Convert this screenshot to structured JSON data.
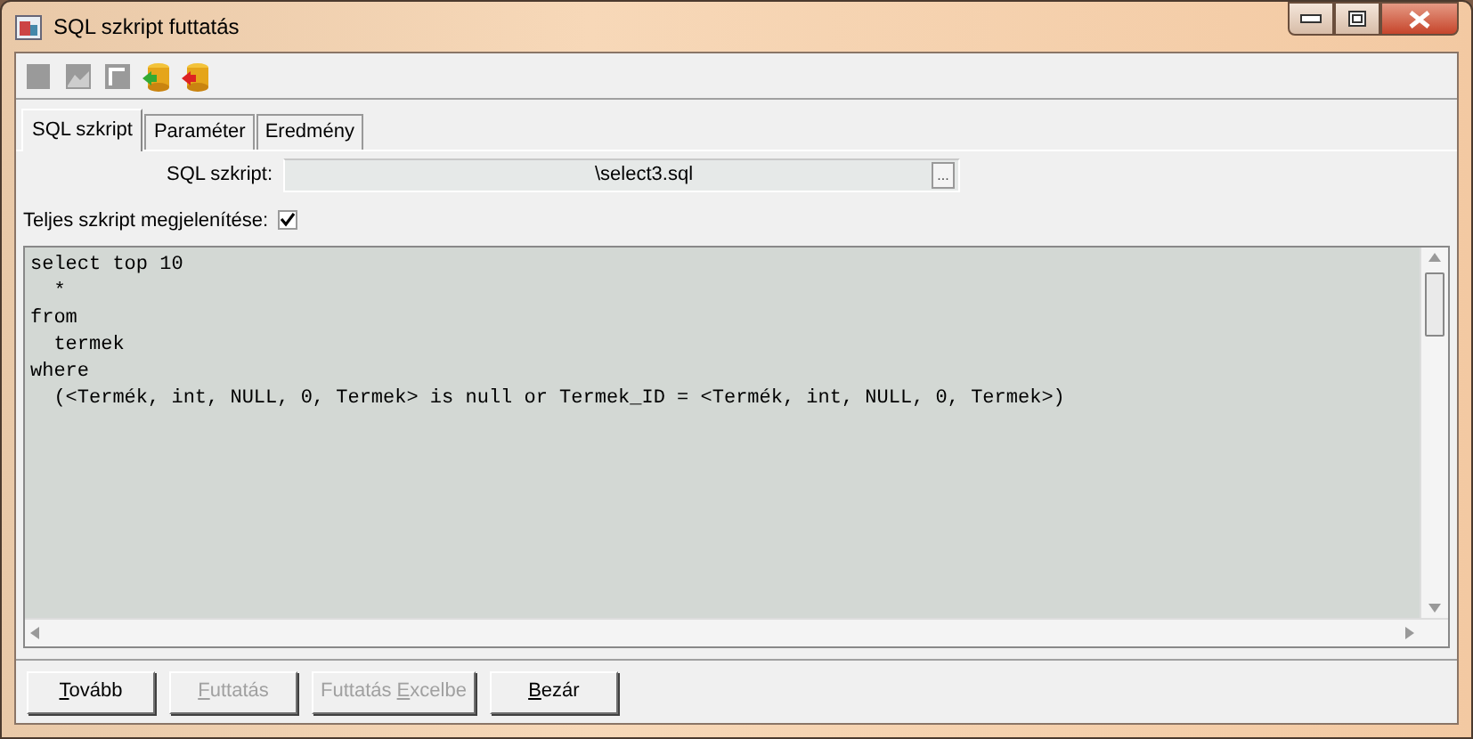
{
  "window": {
    "title": "SQL szkript futtatás"
  },
  "toolbar": [
    {
      "disabled": true
    },
    {
      "disabled": true
    },
    {
      "disabled": true
    },
    {
      "disabled": false
    },
    {
      "disabled": false
    }
  ],
  "tabs": [
    {
      "label": "SQL szkript",
      "selected": true
    },
    {
      "label": "Paraméter",
      "selected": false
    },
    {
      "label": "Eredmény",
      "selected": false
    }
  ],
  "script_field": {
    "label": "SQL szkript:",
    "value": "\\select3.sql",
    "browse": "..."
  },
  "show_full": {
    "label": "Teljes szkript megjelenítése:",
    "checked": true
  },
  "editor_lines": [
    "select top 10",
    "  *",
    "from",
    "  termek",
    "where",
    "  (<Termék, int, NULL, 0, Termek> is null or Termek_ID = <Termék, int, NULL, 0, Termek>)"
  ],
  "buttons": [
    {
      "key": "T",
      "rest": "ovább",
      "disabled": false
    },
    {
      "key": "F",
      "rest": "uttatás",
      "disabled": true
    },
    {
      "prefix": "Futtatás ",
      "key": "E",
      "rest": "xcelbe",
      "disabled": true
    },
    {
      "key": "B",
      "rest": "ezár",
      "disabled": false
    }
  ]
}
